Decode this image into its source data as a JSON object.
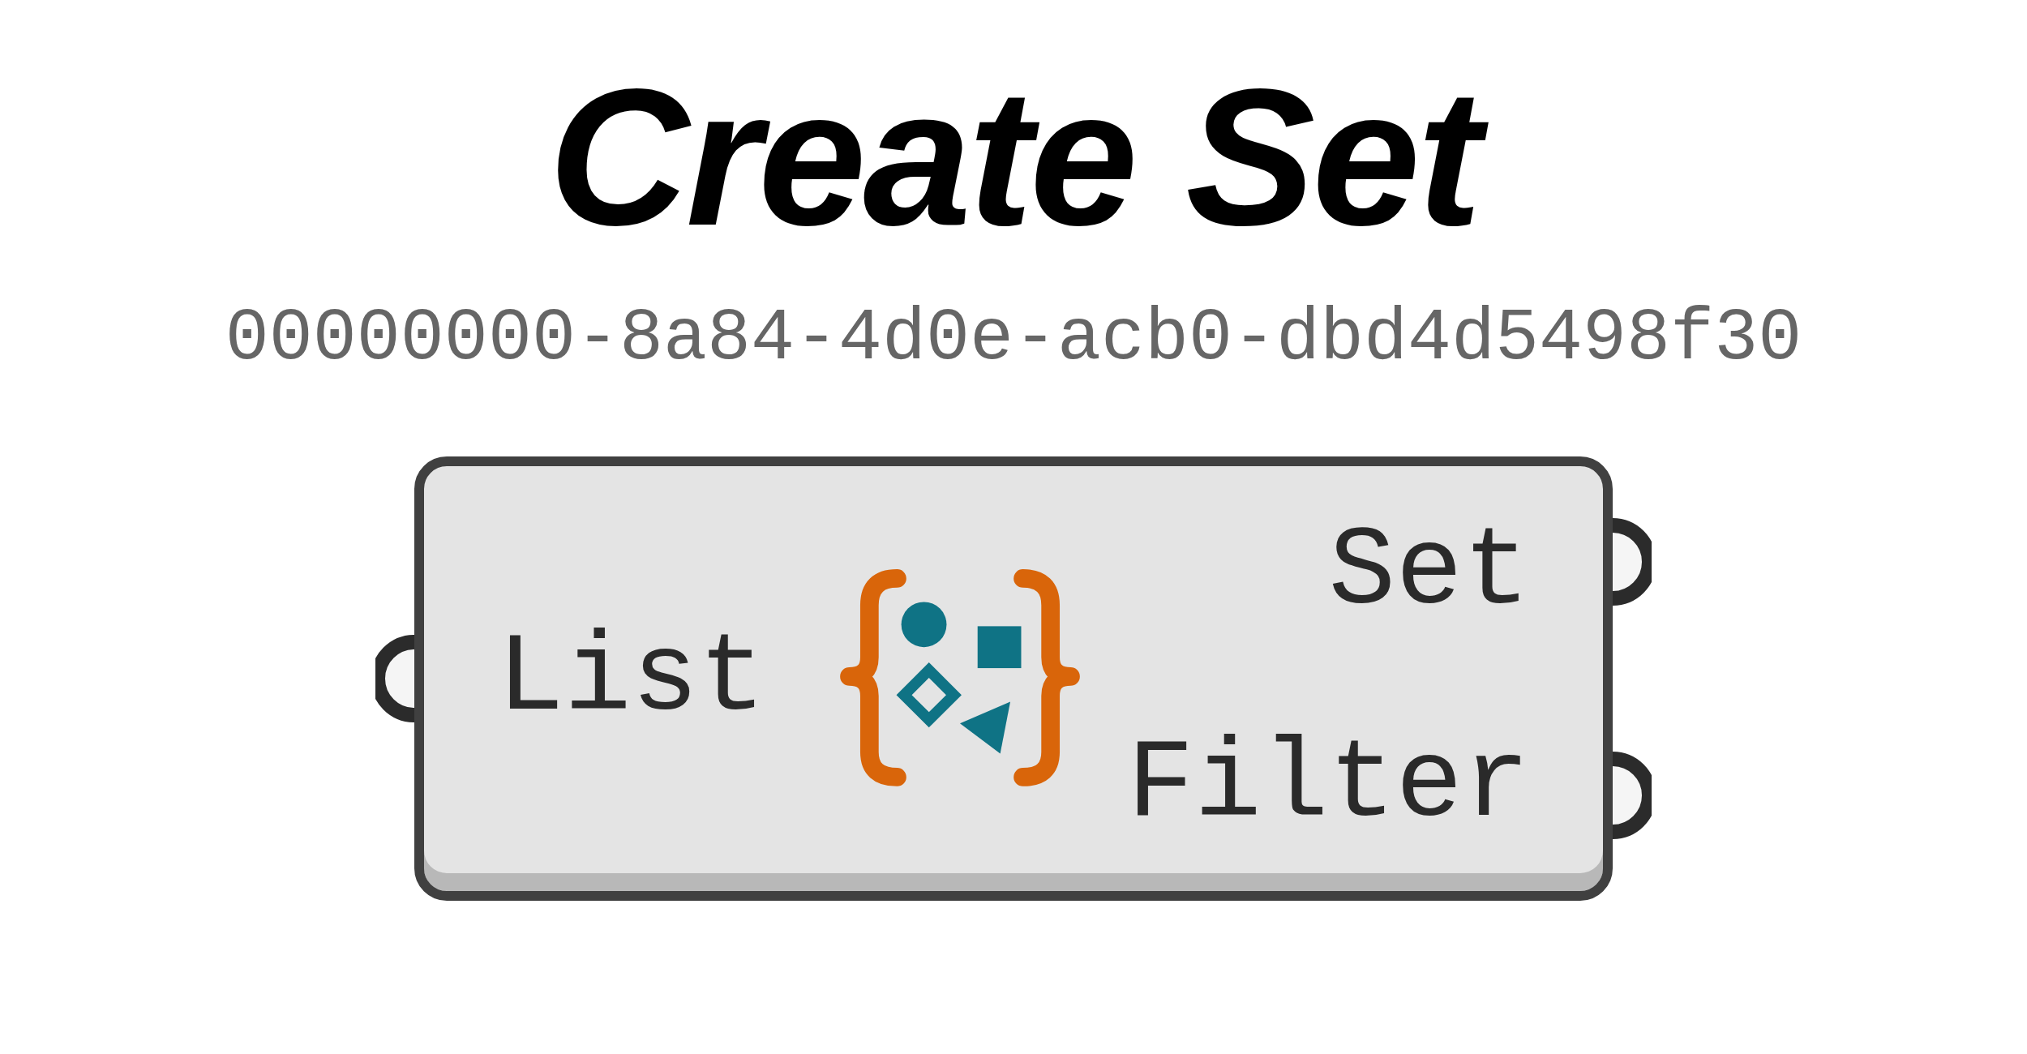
{
  "title": "Create Set",
  "guid": "00000000-8a84-4d0e-acb0-dbd4d5498f30",
  "component": {
    "inputs": [
      {
        "label": "List"
      }
    ],
    "outputs": [
      {
        "label": "Set"
      },
      {
        "label": "Filter"
      }
    ]
  }
}
